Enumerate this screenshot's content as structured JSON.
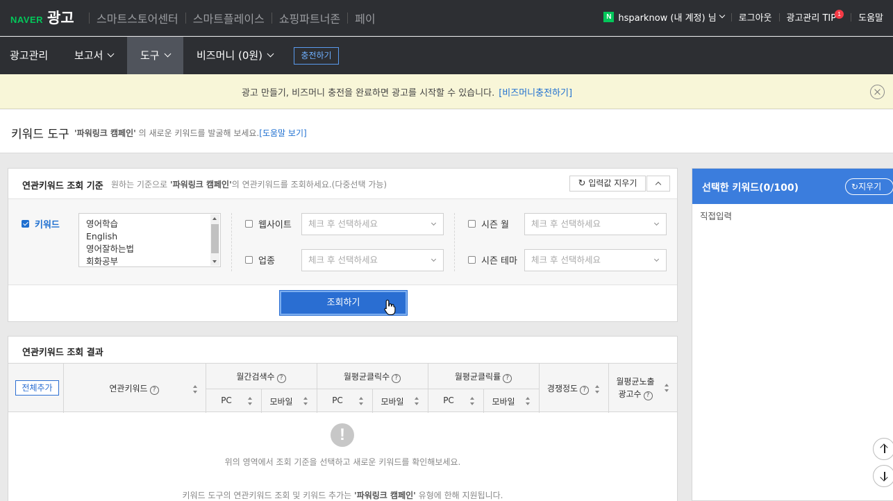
{
  "topbar": {
    "brand_naver": "NAVER",
    "brand_label": "광고",
    "nav": [
      "스마트스토어센터",
      "스마트플레이스",
      "쇼핑파트너존",
      "페이"
    ],
    "user": "hsparknow (내 계정) 님",
    "logout": "로그아웃",
    "tip": "광고관리 TIP",
    "tip_count": "1",
    "help": "도움말"
  },
  "subnav": {
    "items": [
      "광고관리",
      "보고서",
      "도구",
      "비즈머니 (0원)"
    ],
    "active": "도구",
    "charge": "충전하기"
  },
  "notice": {
    "message": "광고 만들기, 비즈머니 충전을 완료하면 광고를 시작할 수 있습니다.",
    "link": "[비즈머니충전하기]"
  },
  "page": {
    "title": "키워드 도구",
    "campaign": "'파워링크 캠페인'",
    "desc_rest": "의 새로운 키워드를 발굴해 보세요.",
    "help_link": "[도움말 보기]"
  },
  "criteria": {
    "heading": "연관키워드 조회 기준",
    "sub_pre": "원하는 기준으로",
    "sub_campaign": "'파워링크 캠페인'",
    "sub_post": "의 연관키워드를 조회하세요.(다중선택 가능)",
    "clear": "입력값 지우기",
    "keyword_label": "키워드",
    "keywords": [
      "영어학습",
      "English",
      "영어잘하는법",
      "회화공부"
    ],
    "website_label": "웹사이트",
    "industry_label": "업종",
    "season_month_label": "시즌 월",
    "season_theme_label": "시즌 테마",
    "select_placeholder": "체크 후 선택하세요",
    "search_button": "조회하기"
  },
  "results": {
    "heading": "연관키워드 조회 결과",
    "add_all": "전체추가",
    "col_keyword": "연관키워드",
    "col_monthly_search": "월간검색수",
    "col_avg_clicks": "월평균클릭수",
    "col_avg_ctr": "월평균클릭률",
    "col_competition": "경쟁정도",
    "col_exposure_line1": "월평균노출",
    "col_exposure_line2": "광고수",
    "pc": "PC",
    "mobile": "모바일",
    "help_mark": "?",
    "empty_msg": "위의 영역에서 조회 기준을 선택하고 새로운 키워드를 확인해보세요.",
    "note_pre": "키워드 도구의 연관키워드 조회 및 키워드 추가는",
    "note_campaign": "'파워링크 캠페인'",
    "note_post": "유형에 한해 지원됩니다."
  },
  "selected": {
    "title": "선택한 키워드(0/100)",
    "clear": "지우기",
    "direct_input": "직접입력"
  },
  "colors": {
    "topbar_bg": "#2d2f33",
    "accent_blue": "#2a6ed2",
    "notice_bg": "#f8f6d8",
    "naver_green": "#03c75a"
  }
}
